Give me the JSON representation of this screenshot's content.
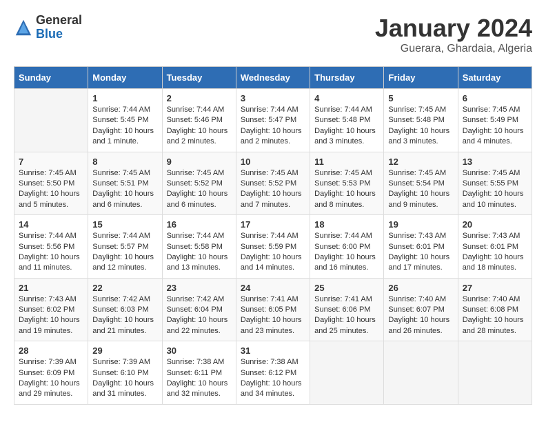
{
  "header": {
    "logo_general": "General",
    "logo_blue": "Blue",
    "month_title": "January 2024",
    "location": "Guerara, Ghardaia, Algeria"
  },
  "days_of_week": [
    "Sunday",
    "Monday",
    "Tuesday",
    "Wednesday",
    "Thursday",
    "Friday",
    "Saturday"
  ],
  "weeks": [
    [
      {
        "day": "",
        "sunrise": "",
        "sunset": "",
        "daylight": ""
      },
      {
        "day": "1",
        "sunrise": "Sunrise: 7:44 AM",
        "sunset": "Sunset: 5:45 PM",
        "daylight": "Daylight: 10 hours and 1 minute."
      },
      {
        "day": "2",
        "sunrise": "Sunrise: 7:44 AM",
        "sunset": "Sunset: 5:46 PM",
        "daylight": "Daylight: 10 hours and 2 minutes."
      },
      {
        "day": "3",
        "sunrise": "Sunrise: 7:44 AM",
        "sunset": "Sunset: 5:47 PM",
        "daylight": "Daylight: 10 hours and 2 minutes."
      },
      {
        "day": "4",
        "sunrise": "Sunrise: 7:44 AM",
        "sunset": "Sunset: 5:48 PM",
        "daylight": "Daylight: 10 hours and 3 minutes."
      },
      {
        "day": "5",
        "sunrise": "Sunrise: 7:45 AM",
        "sunset": "Sunset: 5:48 PM",
        "daylight": "Daylight: 10 hours and 3 minutes."
      },
      {
        "day": "6",
        "sunrise": "Sunrise: 7:45 AM",
        "sunset": "Sunset: 5:49 PM",
        "daylight": "Daylight: 10 hours and 4 minutes."
      }
    ],
    [
      {
        "day": "7",
        "sunrise": "Sunrise: 7:45 AM",
        "sunset": "Sunset: 5:50 PM",
        "daylight": "Daylight: 10 hours and 5 minutes."
      },
      {
        "day": "8",
        "sunrise": "Sunrise: 7:45 AM",
        "sunset": "Sunset: 5:51 PM",
        "daylight": "Daylight: 10 hours and 6 minutes."
      },
      {
        "day": "9",
        "sunrise": "Sunrise: 7:45 AM",
        "sunset": "Sunset: 5:52 PM",
        "daylight": "Daylight: 10 hours and 6 minutes."
      },
      {
        "day": "10",
        "sunrise": "Sunrise: 7:45 AM",
        "sunset": "Sunset: 5:52 PM",
        "daylight": "Daylight: 10 hours and 7 minutes."
      },
      {
        "day": "11",
        "sunrise": "Sunrise: 7:45 AM",
        "sunset": "Sunset: 5:53 PM",
        "daylight": "Daylight: 10 hours and 8 minutes."
      },
      {
        "day": "12",
        "sunrise": "Sunrise: 7:45 AM",
        "sunset": "Sunset: 5:54 PM",
        "daylight": "Daylight: 10 hours and 9 minutes."
      },
      {
        "day": "13",
        "sunrise": "Sunrise: 7:45 AM",
        "sunset": "Sunset: 5:55 PM",
        "daylight": "Daylight: 10 hours and 10 minutes."
      }
    ],
    [
      {
        "day": "14",
        "sunrise": "Sunrise: 7:44 AM",
        "sunset": "Sunset: 5:56 PM",
        "daylight": "Daylight: 10 hours and 11 minutes."
      },
      {
        "day": "15",
        "sunrise": "Sunrise: 7:44 AM",
        "sunset": "Sunset: 5:57 PM",
        "daylight": "Daylight: 10 hours and 12 minutes."
      },
      {
        "day": "16",
        "sunrise": "Sunrise: 7:44 AM",
        "sunset": "Sunset: 5:58 PM",
        "daylight": "Daylight: 10 hours and 13 minutes."
      },
      {
        "day": "17",
        "sunrise": "Sunrise: 7:44 AM",
        "sunset": "Sunset: 5:59 PM",
        "daylight": "Daylight: 10 hours and 14 minutes."
      },
      {
        "day": "18",
        "sunrise": "Sunrise: 7:44 AM",
        "sunset": "Sunset: 6:00 PM",
        "daylight": "Daylight: 10 hours and 16 minutes."
      },
      {
        "day": "19",
        "sunrise": "Sunrise: 7:43 AM",
        "sunset": "Sunset: 6:01 PM",
        "daylight": "Daylight: 10 hours and 17 minutes."
      },
      {
        "day": "20",
        "sunrise": "Sunrise: 7:43 AM",
        "sunset": "Sunset: 6:01 PM",
        "daylight": "Daylight: 10 hours and 18 minutes."
      }
    ],
    [
      {
        "day": "21",
        "sunrise": "Sunrise: 7:43 AM",
        "sunset": "Sunset: 6:02 PM",
        "daylight": "Daylight: 10 hours and 19 minutes."
      },
      {
        "day": "22",
        "sunrise": "Sunrise: 7:42 AM",
        "sunset": "Sunset: 6:03 PM",
        "daylight": "Daylight: 10 hours and 21 minutes."
      },
      {
        "day": "23",
        "sunrise": "Sunrise: 7:42 AM",
        "sunset": "Sunset: 6:04 PM",
        "daylight": "Daylight: 10 hours and 22 minutes."
      },
      {
        "day": "24",
        "sunrise": "Sunrise: 7:41 AM",
        "sunset": "Sunset: 6:05 PM",
        "daylight": "Daylight: 10 hours and 23 minutes."
      },
      {
        "day": "25",
        "sunrise": "Sunrise: 7:41 AM",
        "sunset": "Sunset: 6:06 PM",
        "daylight": "Daylight: 10 hours and 25 minutes."
      },
      {
        "day": "26",
        "sunrise": "Sunrise: 7:40 AM",
        "sunset": "Sunset: 6:07 PM",
        "daylight": "Daylight: 10 hours and 26 minutes."
      },
      {
        "day": "27",
        "sunrise": "Sunrise: 7:40 AM",
        "sunset": "Sunset: 6:08 PM",
        "daylight": "Daylight: 10 hours and 28 minutes."
      }
    ],
    [
      {
        "day": "28",
        "sunrise": "Sunrise: 7:39 AM",
        "sunset": "Sunset: 6:09 PM",
        "daylight": "Daylight: 10 hours and 29 minutes."
      },
      {
        "day": "29",
        "sunrise": "Sunrise: 7:39 AM",
        "sunset": "Sunset: 6:10 PM",
        "daylight": "Daylight: 10 hours and 31 minutes."
      },
      {
        "day": "30",
        "sunrise": "Sunrise: 7:38 AM",
        "sunset": "Sunset: 6:11 PM",
        "daylight": "Daylight: 10 hours and 32 minutes."
      },
      {
        "day": "31",
        "sunrise": "Sunrise: 7:38 AM",
        "sunset": "Sunset: 6:12 PM",
        "daylight": "Daylight: 10 hours and 34 minutes."
      },
      {
        "day": "",
        "sunrise": "",
        "sunset": "",
        "daylight": ""
      },
      {
        "day": "",
        "sunrise": "",
        "sunset": "",
        "daylight": ""
      },
      {
        "day": "",
        "sunrise": "",
        "sunset": "",
        "daylight": ""
      }
    ]
  ]
}
